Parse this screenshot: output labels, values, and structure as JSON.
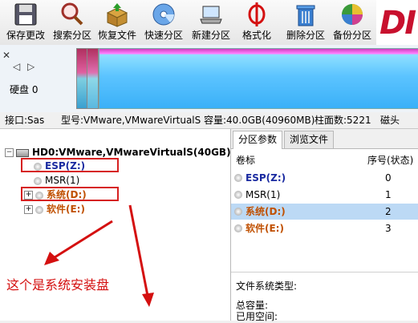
{
  "toolbar": {
    "buttons": [
      {
        "label": "保存更改",
        "icon": "floppy-icon"
      },
      {
        "label": "搜索分区",
        "icon": "magnifier-icon"
      },
      {
        "label": "恢复文件",
        "icon": "restore-box-icon"
      },
      {
        "label": "快速分区",
        "icon": "quick-partition-disc-icon"
      },
      {
        "label": "新建分区",
        "icon": "laptop-new-icon"
      },
      {
        "label": "格式化",
        "icon": "format-phi-icon"
      },
      {
        "label": "删除分区",
        "icon": "trash-icon"
      },
      {
        "label": "备份分区",
        "icon": "backup-pie-icon"
      }
    ],
    "brand_text": "DI"
  },
  "diskmap": {
    "disk_label": "硬盘 0",
    "nav_left": "◁",
    "nav_right": "▷",
    "pin": "✕"
  },
  "infoline": {
    "interface": "接口:Sas",
    "model": "型号:VMware,VMwareVirtualS",
    "capacity": "容量:40.0GB(40960MB)",
    "cylinders": "柱面数:5221",
    "heads": "磁头"
  },
  "tree": {
    "disk": "HD0:VMware,VMwareVirtualS(40GB)",
    "partitions": [
      {
        "label": "ESP(Z:)"
      },
      {
        "label": "MSR(1)"
      },
      {
        "label": "系统(D:)"
      },
      {
        "label": "软件(E:)"
      }
    ],
    "annotation": "这个是系统安装盘"
  },
  "right": {
    "tabs": [
      "分区参数",
      "浏览文件"
    ],
    "headers": {
      "volume": "卷标",
      "seq": "序号(状态)"
    },
    "rows": [
      {
        "name": "ESP(Z:)",
        "seq": "0"
      },
      {
        "name": "MSR(1)",
        "seq": "1"
      },
      {
        "name": "系统(D:)",
        "seq": "2"
      },
      {
        "name": "软件(E:)",
        "seq": "3"
      }
    ],
    "fs_type_label": "文件系统类型:",
    "total_label": "总容量:",
    "used_label": "已用空间:"
  },
  "colors": {
    "accent_red": "#d62020",
    "selected_row": "#bcd9f5"
  }
}
